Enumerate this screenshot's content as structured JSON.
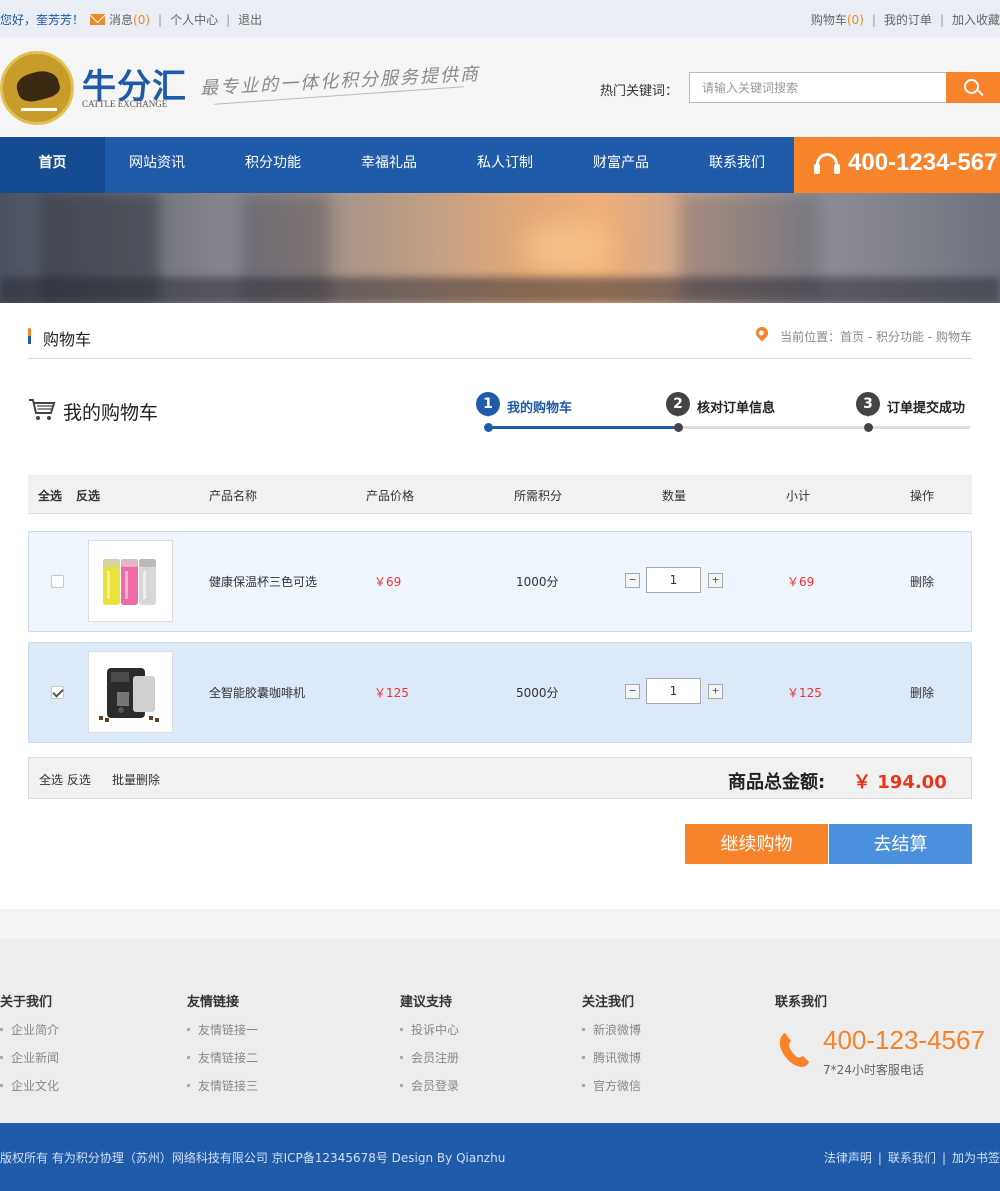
{
  "topbar": {
    "greeting": "您好，奎芳芳！",
    "messages_label": "消息",
    "messages_count": "(0)",
    "user_center": "个人中心",
    "logout": "退出",
    "cart_label": "购物车",
    "cart_count": "(0)",
    "my_orders": "我的订单",
    "add_favorite": "加入收藏"
  },
  "header": {
    "logo_cn": "牛分汇",
    "logo_en": "CATTLE EXCHANGE",
    "slogan": "最专业的一体化积分服务提供商",
    "hot_keywords_label": "热门关键词：",
    "search_placeholder": "请输入关键词搜索"
  },
  "nav": {
    "items": [
      "首页",
      "网站资讯",
      "积分功能",
      "幸福礼品",
      "私人订制",
      "财富产品",
      "联系我们"
    ],
    "hotline": "400-1234-567"
  },
  "page": {
    "title": "购物车",
    "breadcrumb": "当前位置：首页 - 积分功能 - 购物车"
  },
  "cart": {
    "heading": "我的购物车",
    "steps": [
      {
        "num": "1",
        "label": "我的购物车"
      },
      {
        "num": "2",
        "label": "核对订单信息"
      },
      {
        "num": "3",
        "label": "订单提交成功"
      }
    ],
    "columns": {
      "select_all": "全选",
      "invert": "反选",
      "name": "产品名称",
      "price": "产品价格",
      "points": "所需积分",
      "quantity": "数量",
      "subtotal": "小计",
      "action": "操作"
    },
    "items": [
      {
        "name": "健康保温杯三色可选",
        "price": "￥69",
        "points": "1000分",
        "quantity": "1",
        "subtotal": "￥69",
        "action": "删除",
        "checked": false
      },
      {
        "name": "全智能胶囊咖啡机",
        "price": "￥125",
        "points": "5000分",
        "quantity": "1",
        "subtotal": "￥125",
        "action": "删除",
        "checked": true
      }
    ],
    "footer": {
      "select_invert": "全选 反选",
      "batch_delete": "批量删除",
      "total_label": "商品总金额:",
      "total_value": "￥ 194.00"
    },
    "continue_button": "继续购物",
    "checkout_button": "去结算"
  },
  "footer": {
    "columns": [
      {
        "title": "关于我们",
        "links": [
          "企业简介",
          "企业新闻",
          "企业文化"
        ]
      },
      {
        "title": "友情链接",
        "links": [
          "友情链接一",
          "友情链接二",
          "友情链接三"
        ]
      },
      {
        "title": "建议支持",
        "links": [
          "投诉中心",
          "会员注册",
          "会员登录"
        ]
      },
      {
        "title": "关注我们",
        "links": [
          "新浪微博",
          "腾讯微博",
          "官方微信"
        ]
      }
    ],
    "contact_title": "联系我们",
    "contact_phone": "400-123-4567",
    "contact_note": "7*24小时客服电话"
  },
  "copyright": {
    "text": "版权所有  有为积分协理（苏州）网络科技有限公司    京ICP备12345678号    Design By Qianzhu",
    "links": [
      "法律声明",
      "联系我们",
      "加为书签"
    ]
  },
  "colors": {
    "brand_blue": "#1f5ba9",
    "accent_orange": "#f7832b",
    "price_red": "#e33"
  }
}
